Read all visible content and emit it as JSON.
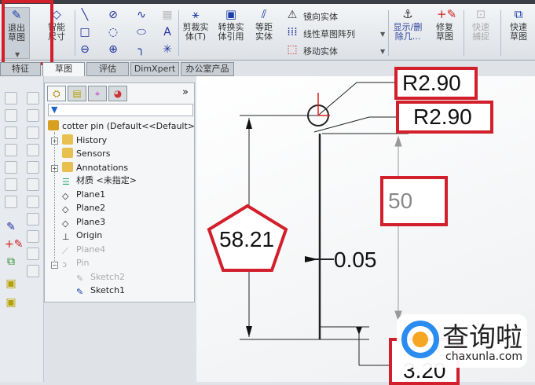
{
  "ribbon": {
    "exit_sketch": "退出草图",
    "smart_dim": "智能尺寸",
    "trim": "剪裁实体(T)",
    "convert": "转换实体引用",
    "offset": "等距实体",
    "mirror": "镜向实体",
    "linear_pattern": "线性草图阵列",
    "move": "移动实体",
    "show_delete": "显示/删除几...",
    "repair": "修复草图",
    "quick_snap": "快速捕捉",
    "rapid_sketch": "快速草图"
  },
  "tabs": [
    "特征",
    "草图",
    "评估",
    "DimXpert",
    "办公室产品"
  ],
  "active_tab": "草图",
  "feature_manager": {
    "root": "cotter pin  (Default<<Default>",
    "items": [
      {
        "label": "History",
        "icon": "history-folder-icon"
      },
      {
        "label": "Sensors",
        "icon": "sensors-folder-icon"
      },
      {
        "label": "Annotations",
        "icon": "annotations-folder-icon"
      },
      {
        "label": "材质 <未指定>",
        "icon": "material-icon"
      },
      {
        "label": "Plane1",
        "icon": "plane-icon"
      },
      {
        "label": "Plane2",
        "icon": "plane-icon"
      },
      {
        "label": "Plane3",
        "icon": "plane-icon"
      },
      {
        "label": "Origin",
        "icon": "origin-icon"
      },
      {
        "label": "Plane4",
        "icon": "plane-icon"
      },
      {
        "label": "Pin",
        "icon": "sweep-feature-icon"
      },
      {
        "label": "Sketch2",
        "icon": "sketch-icon"
      },
      {
        "label": "Sketch1",
        "icon": "sketch-icon"
      }
    ],
    "more": "»"
  },
  "drawing": {
    "dim_r1": "R2.90",
    "dim_r2": "R2.90",
    "dim_50": "50",
    "dim_5821": "58.21",
    "dim_005": "0.05",
    "dim_320": "3.20"
  },
  "watermark": {
    "cn": "查询啦",
    "url": "chaxunla.com"
  },
  "colors": {
    "highlight": "#d11f2b",
    "accent": "#1a3fa8"
  }
}
